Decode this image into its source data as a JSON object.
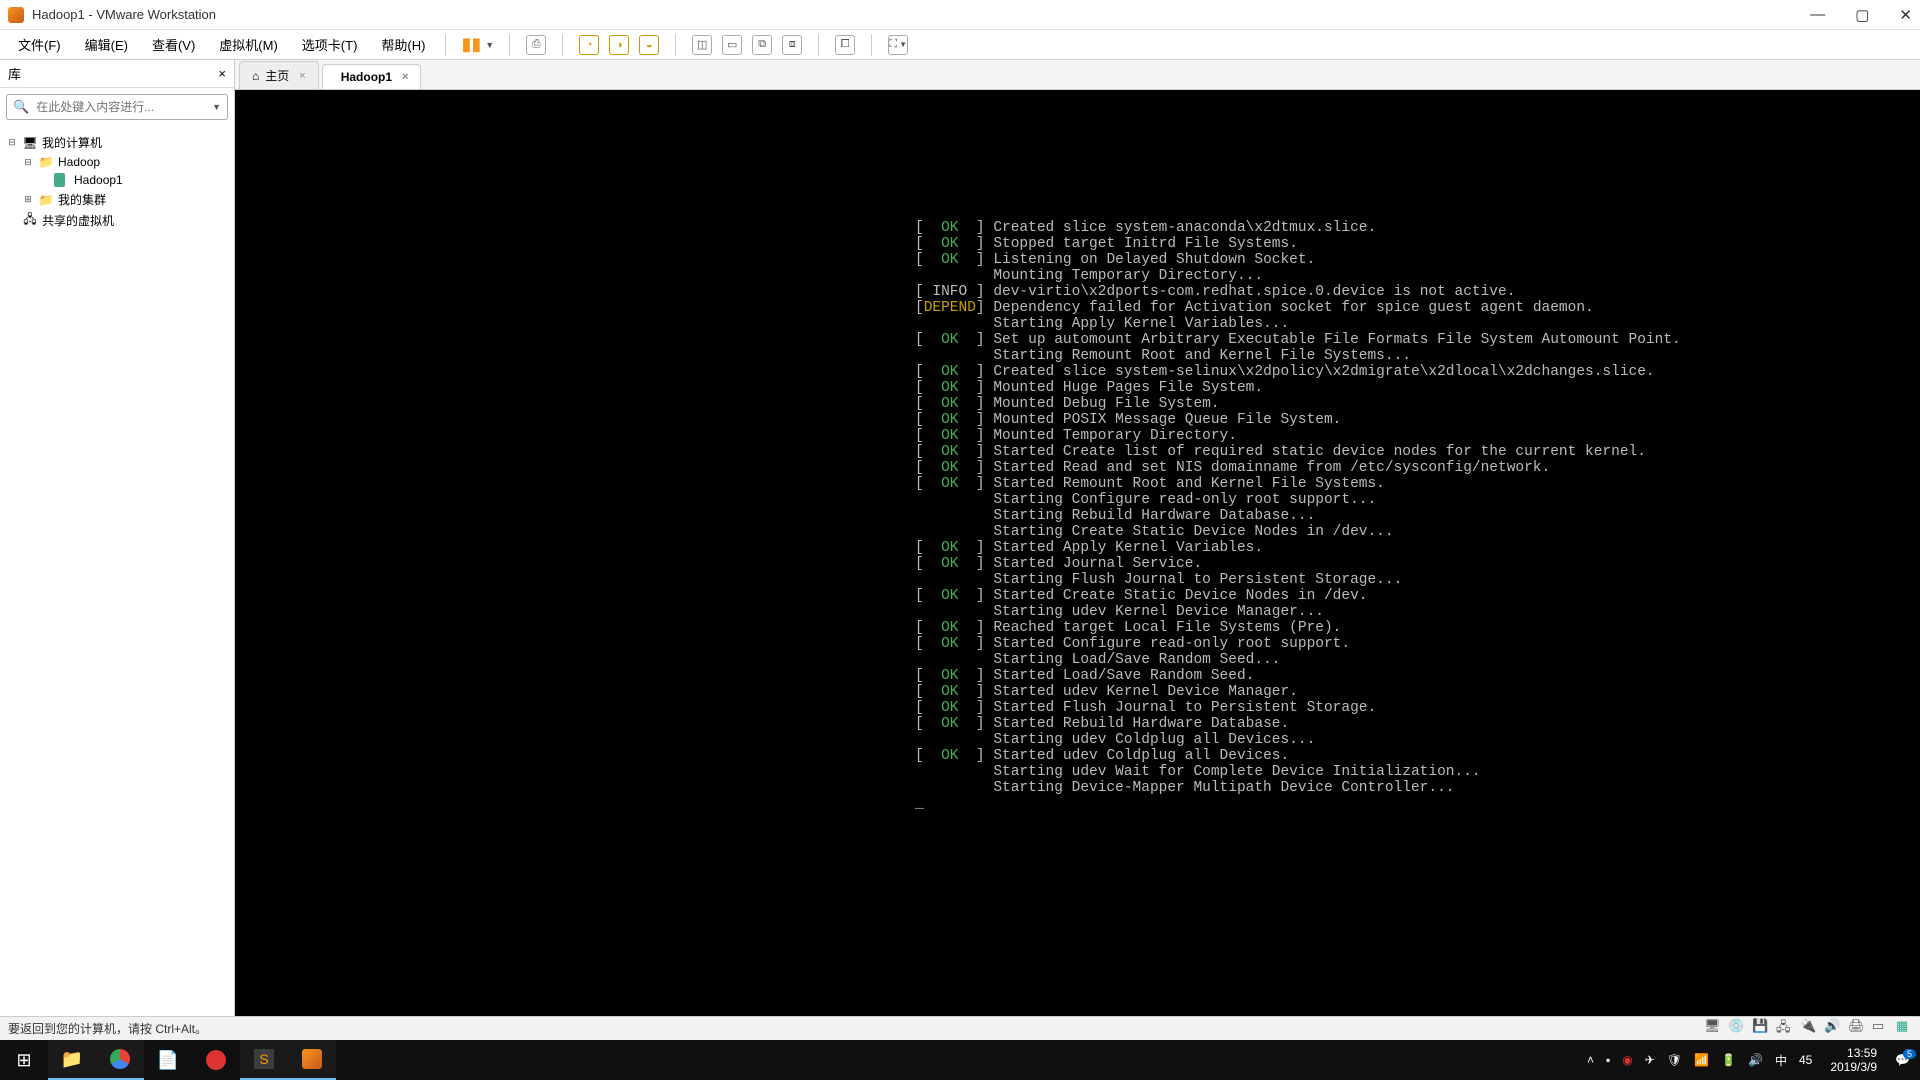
{
  "window": {
    "title": "Hadoop1 - VMware Workstation"
  },
  "menubar": {
    "items": [
      "文件(F)",
      "编辑(E)",
      "查看(V)",
      "虚拟机(M)",
      "选项卡(T)",
      "帮助(H)"
    ]
  },
  "sidebar": {
    "title": "库",
    "search_placeholder": "在此处键入内容进行...",
    "tree": {
      "root": "我的计算机",
      "hadoop": "Hadoop",
      "hadoop1": "Hadoop1",
      "cluster": "我的集群",
      "shared": "共享的虚拟机"
    }
  },
  "tabs": {
    "home": "主页",
    "vm": "Hadoop1"
  },
  "console_lines": [
    {
      "tag": "OK",
      "text": "Created slice system-anaconda\\x2dtmux.slice."
    },
    {
      "tag": "OK",
      "text": "Stopped target Initrd File Systems."
    },
    {
      "tag": "OK",
      "text": "Listening on Delayed Shutdown Socket."
    },
    {
      "tag": "",
      "text": "Mounting Temporary Directory..."
    },
    {
      "tag": "INFO",
      "text": "dev-virtio\\x2dports-com.redhat.spice.0.device is not active."
    },
    {
      "tag": "DEPEND",
      "text": "Dependency failed for Activation socket for spice guest agent daemon."
    },
    {
      "tag": "",
      "text": "Starting Apply Kernel Variables..."
    },
    {
      "tag": "OK",
      "text": "Set up automount Arbitrary Executable File Formats File System Automount Point."
    },
    {
      "tag": "",
      "text": "Starting Remount Root and Kernel File Systems..."
    },
    {
      "tag": "OK",
      "text": "Created slice system-selinux\\x2dpolicy\\x2dmigrate\\x2dlocal\\x2dchanges.slice."
    },
    {
      "tag": "OK",
      "text": "Mounted Huge Pages File System."
    },
    {
      "tag": "OK",
      "text": "Mounted Debug File System."
    },
    {
      "tag": "OK",
      "text": "Mounted POSIX Message Queue File System."
    },
    {
      "tag": "OK",
      "text": "Mounted Temporary Directory."
    },
    {
      "tag": "OK",
      "text": "Started Create list of required static device nodes for the current kernel."
    },
    {
      "tag": "OK",
      "text": "Started Read and set NIS domainname from /etc/sysconfig/network."
    },
    {
      "tag": "OK",
      "text": "Started Remount Root and Kernel File Systems."
    },
    {
      "tag": "",
      "text": "Starting Configure read-only root support..."
    },
    {
      "tag": "",
      "text": "Starting Rebuild Hardware Database..."
    },
    {
      "tag": "",
      "text": "Starting Create Static Device Nodes in /dev..."
    },
    {
      "tag": "OK",
      "text": "Started Apply Kernel Variables."
    },
    {
      "tag": "OK",
      "text": "Started Journal Service."
    },
    {
      "tag": "",
      "text": "Starting Flush Journal to Persistent Storage..."
    },
    {
      "tag": "OK",
      "text": "Started Create Static Device Nodes in /dev."
    },
    {
      "tag": "",
      "text": "Starting udev Kernel Device Manager..."
    },
    {
      "tag": "OK",
      "text": "Reached target Local File Systems (Pre)."
    },
    {
      "tag": "OK",
      "text": "Started Configure read-only root support."
    },
    {
      "tag": "",
      "text": "Starting Load/Save Random Seed..."
    },
    {
      "tag": "OK",
      "text": "Started Load/Save Random Seed."
    },
    {
      "tag": "OK",
      "text": "Started udev Kernel Device Manager."
    },
    {
      "tag": "OK",
      "text": "Started Flush Journal to Persistent Storage."
    },
    {
      "tag": "OK",
      "text": "Started Rebuild Hardware Database."
    },
    {
      "tag": "",
      "text": "Starting udev Coldplug all Devices..."
    },
    {
      "tag": "OK",
      "text": "Started udev Coldplug all Devices."
    },
    {
      "tag": "",
      "text": "Starting udev Wait for Complete Device Initialization..."
    },
    {
      "tag": "",
      "text": "Starting Device-Mapper Multipath Device Controller..."
    }
  ],
  "statusbar": {
    "message": "要返回到您的计算机，请按 Ctrl+Alt。"
  },
  "systray": {
    "input_indicator": "中",
    "battery": "45",
    "time": "13:59",
    "date": "2019/3/9",
    "notif_count": "5"
  }
}
